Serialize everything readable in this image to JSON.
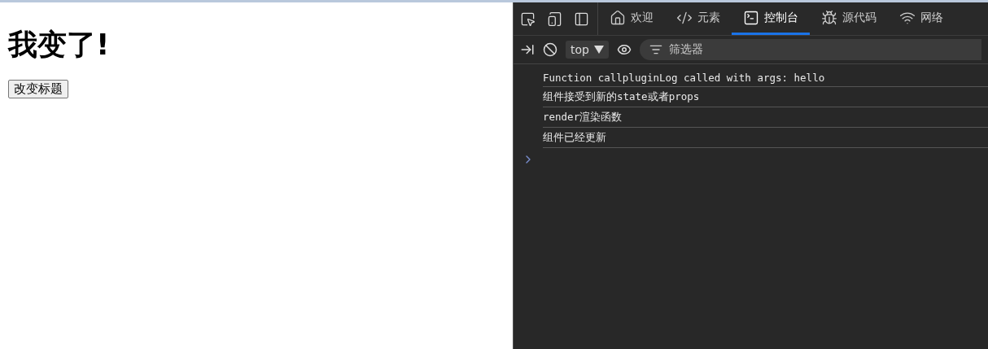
{
  "page": {
    "heading": "我变了!",
    "button": "改变标题"
  },
  "devtools": {
    "tabs": [
      {
        "label": "欢迎",
        "selected": false
      },
      {
        "label": "元素",
        "selected": false
      },
      {
        "label": "控制台",
        "selected": true
      },
      {
        "label": "源代码",
        "selected": false
      },
      {
        "label": "网络",
        "selected": false
      }
    ],
    "context": "top",
    "filter": {
      "placeholder": "筛选器"
    },
    "console": [
      "Function  callpluginLog  called with args: hello",
      "组件接受到新的state或者props",
      "render渲染函数",
      "组件已经更新"
    ]
  }
}
